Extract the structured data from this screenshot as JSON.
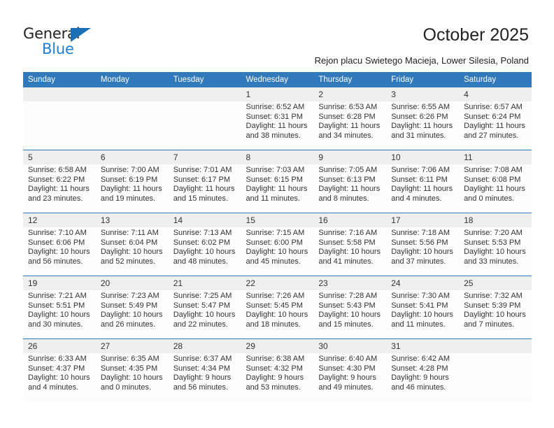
{
  "brand": {
    "name_top": "General",
    "name_bottom": "Blue",
    "accent_color": "#1a7fd4",
    "triangle_color": "#1a6fb5"
  },
  "header": {
    "title": "October 2025",
    "subtitle": "Rejon placu Swietego Macieja, Lower Silesia, Poland"
  },
  "calendar": {
    "header_bg": "#3279bc",
    "daynum_bg": "#efefef",
    "weekday_labels": [
      "Sunday",
      "Monday",
      "Tuesday",
      "Wednesday",
      "Thursday",
      "Friday",
      "Saturday"
    ],
    "weeks": [
      {
        "days": [
          {
            "num": "",
            "lines": []
          },
          {
            "num": "",
            "lines": []
          },
          {
            "num": "",
            "lines": []
          },
          {
            "num": "1",
            "lines": [
              "Sunrise: 6:52 AM",
              "Sunset: 6:31 PM",
              "Daylight: 11 hours",
              "and 38 minutes."
            ]
          },
          {
            "num": "2",
            "lines": [
              "Sunrise: 6:53 AM",
              "Sunset: 6:28 PM",
              "Daylight: 11 hours",
              "and 34 minutes."
            ]
          },
          {
            "num": "3",
            "lines": [
              "Sunrise: 6:55 AM",
              "Sunset: 6:26 PM",
              "Daylight: 11 hours",
              "and 31 minutes."
            ]
          },
          {
            "num": "4",
            "lines": [
              "Sunrise: 6:57 AM",
              "Sunset: 6:24 PM",
              "Daylight: 11 hours",
              "and 27 minutes."
            ]
          }
        ]
      },
      {
        "days": [
          {
            "num": "5",
            "lines": [
              "Sunrise: 6:58 AM",
              "Sunset: 6:22 PM",
              "Daylight: 11 hours",
              "and 23 minutes."
            ]
          },
          {
            "num": "6",
            "lines": [
              "Sunrise: 7:00 AM",
              "Sunset: 6:19 PM",
              "Daylight: 11 hours",
              "and 19 minutes."
            ]
          },
          {
            "num": "7",
            "lines": [
              "Sunrise: 7:01 AM",
              "Sunset: 6:17 PM",
              "Daylight: 11 hours",
              "and 15 minutes."
            ]
          },
          {
            "num": "8",
            "lines": [
              "Sunrise: 7:03 AM",
              "Sunset: 6:15 PM",
              "Daylight: 11 hours",
              "and 11 minutes."
            ]
          },
          {
            "num": "9",
            "lines": [
              "Sunrise: 7:05 AM",
              "Sunset: 6:13 PM",
              "Daylight: 11 hours",
              "and 8 minutes."
            ]
          },
          {
            "num": "10",
            "lines": [
              "Sunrise: 7:06 AM",
              "Sunset: 6:11 PM",
              "Daylight: 11 hours",
              "and 4 minutes."
            ]
          },
          {
            "num": "11",
            "lines": [
              "Sunrise: 7:08 AM",
              "Sunset: 6:08 PM",
              "Daylight: 11 hours",
              "and 0 minutes."
            ]
          }
        ]
      },
      {
        "days": [
          {
            "num": "12",
            "lines": [
              "Sunrise: 7:10 AM",
              "Sunset: 6:06 PM",
              "Daylight: 10 hours",
              "and 56 minutes."
            ]
          },
          {
            "num": "13",
            "lines": [
              "Sunrise: 7:11 AM",
              "Sunset: 6:04 PM",
              "Daylight: 10 hours",
              "and 52 minutes."
            ]
          },
          {
            "num": "14",
            "lines": [
              "Sunrise: 7:13 AM",
              "Sunset: 6:02 PM",
              "Daylight: 10 hours",
              "and 48 minutes."
            ]
          },
          {
            "num": "15",
            "lines": [
              "Sunrise: 7:15 AM",
              "Sunset: 6:00 PM",
              "Daylight: 10 hours",
              "and 45 minutes."
            ]
          },
          {
            "num": "16",
            "lines": [
              "Sunrise: 7:16 AM",
              "Sunset: 5:58 PM",
              "Daylight: 10 hours",
              "and 41 minutes."
            ]
          },
          {
            "num": "17",
            "lines": [
              "Sunrise: 7:18 AM",
              "Sunset: 5:56 PM",
              "Daylight: 10 hours",
              "and 37 minutes."
            ]
          },
          {
            "num": "18",
            "lines": [
              "Sunrise: 7:20 AM",
              "Sunset: 5:53 PM",
              "Daylight: 10 hours",
              "and 33 minutes."
            ]
          }
        ]
      },
      {
        "days": [
          {
            "num": "19",
            "lines": [
              "Sunrise: 7:21 AM",
              "Sunset: 5:51 PM",
              "Daylight: 10 hours",
              "and 30 minutes."
            ]
          },
          {
            "num": "20",
            "lines": [
              "Sunrise: 7:23 AM",
              "Sunset: 5:49 PM",
              "Daylight: 10 hours",
              "and 26 minutes."
            ]
          },
          {
            "num": "21",
            "lines": [
              "Sunrise: 7:25 AM",
              "Sunset: 5:47 PM",
              "Daylight: 10 hours",
              "and 22 minutes."
            ]
          },
          {
            "num": "22",
            "lines": [
              "Sunrise: 7:26 AM",
              "Sunset: 5:45 PM",
              "Daylight: 10 hours",
              "and 18 minutes."
            ]
          },
          {
            "num": "23",
            "lines": [
              "Sunrise: 7:28 AM",
              "Sunset: 5:43 PM",
              "Daylight: 10 hours",
              "and 15 minutes."
            ]
          },
          {
            "num": "24",
            "lines": [
              "Sunrise: 7:30 AM",
              "Sunset: 5:41 PM",
              "Daylight: 10 hours",
              "and 11 minutes."
            ]
          },
          {
            "num": "25",
            "lines": [
              "Sunrise: 7:32 AM",
              "Sunset: 5:39 PM",
              "Daylight: 10 hours",
              "and 7 minutes."
            ]
          }
        ]
      },
      {
        "days": [
          {
            "num": "26",
            "lines": [
              "Sunrise: 6:33 AM",
              "Sunset: 4:37 PM",
              "Daylight: 10 hours",
              "and 4 minutes."
            ]
          },
          {
            "num": "27",
            "lines": [
              "Sunrise: 6:35 AM",
              "Sunset: 4:35 PM",
              "Daylight: 10 hours",
              "and 0 minutes."
            ]
          },
          {
            "num": "28",
            "lines": [
              "Sunrise: 6:37 AM",
              "Sunset: 4:34 PM",
              "Daylight: 9 hours",
              "and 56 minutes."
            ]
          },
          {
            "num": "29",
            "lines": [
              "Sunrise: 6:38 AM",
              "Sunset: 4:32 PM",
              "Daylight: 9 hours",
              "and 53 minutes."
            ]
          },
          {
            "num": "30",
            "lines": [
              "Sunrise: 6:40 AM",
              "Sunset: 4:30 PM",
              "Daylight: 9 hours",
              "and 49 minutes."
            ]
          },
          {
            "num": "31",
            "lines": [
              "Sunrise: 6:42 AM",
              "Sunset: 4:28 PM",
              "Daylight: 9 hours",
              "and 46 minutes."
            ]
          },
          {
            "num": "",
            "lines": []
          }
        ]
      }
    ]
  }
}
